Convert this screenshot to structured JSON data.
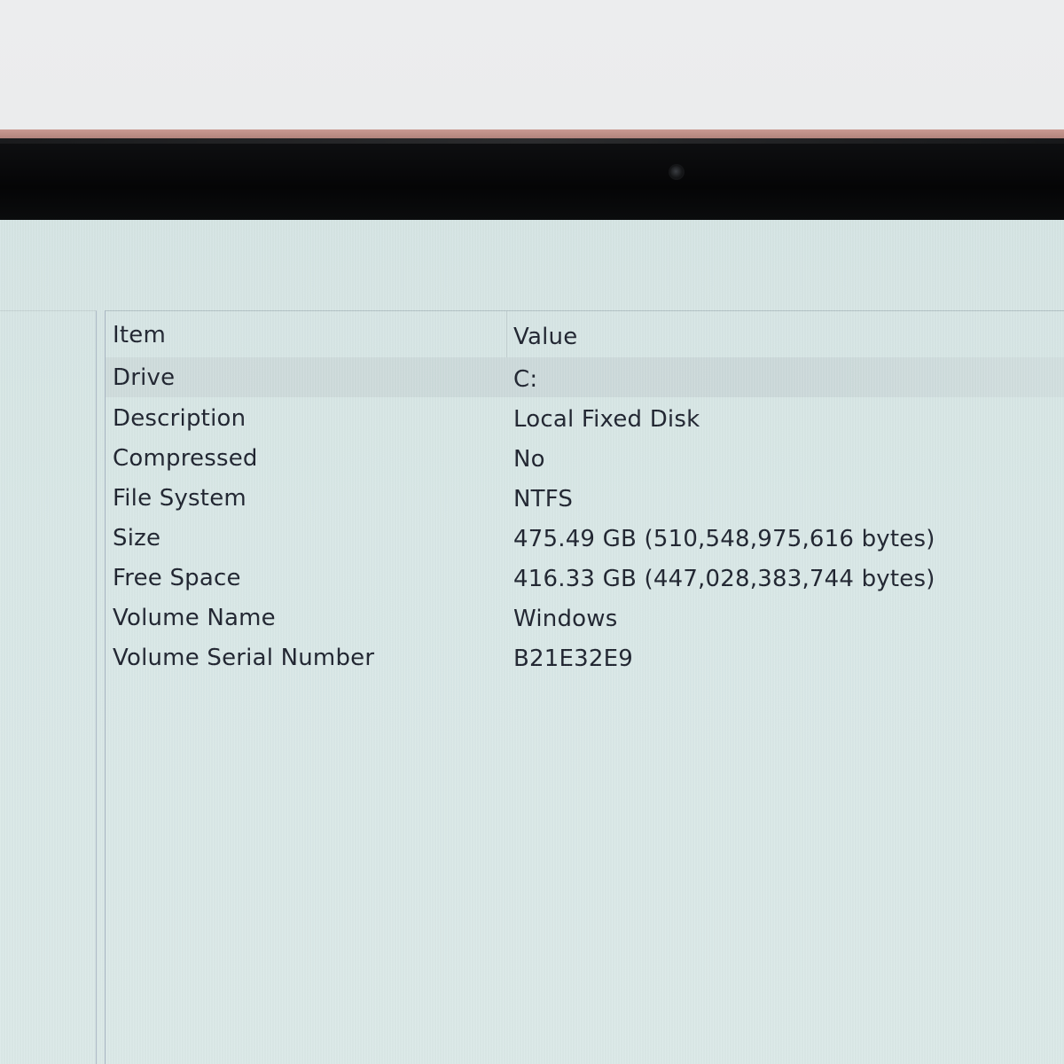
{
  "table": {
    "columns": [
      "Item",
      "Value"
    ],
    "rows": [
      {
        "item": "Drive",
        "value": "C:"
      },
      {
        "item": "Description",
        "value": "Local Fixed Disk"
      },
      {
        "item": "Compressed",
        "value": "No"
      },
      {
        "item": "File System",
        "value": "NTFS"
      },
      {
        "item": "Size",
        "value": "475.49 GB (510,548,975,616 bytes)"
      },
      {
        "item": "Free Space",
        "value": "416.33 GB (447,028,383,744 bytes)"
      },
      {
        "item": "Volume Name",
        "value": "Windows"
      },
      {
        "item": "Volume Serial Number",
        "value": "B21E32E9"
      }
    ]
  },
  "colors": {
    "screen_background": "#d9e8e7",
    "text": "#1f2430",
    "selected_row": "#ccd9da",
    "bezel": "#050506",
    "lid": "#c99a92"
  }
}
